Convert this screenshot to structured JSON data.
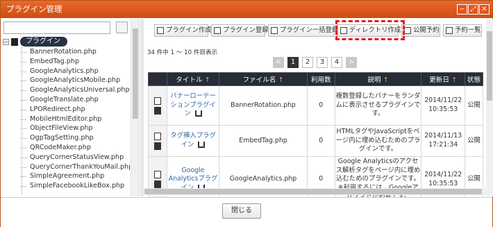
{
  "window": {
    "title": "プラグイン管理",
    "minimize_icon": "minimize-icon",
    "maximize_icon": "maximize-icon",
    "close_icon": "close-icon"
  },
  "sidebar": {
    "search_placeholder": "",
    "root_label": "プラグイン",
    "items": [
      "BannerRotation.php",
      "EmbedTag.php",
      "GoogleAnalytics.php",
      "GoogleAnalyticsMobile.php",
      "GoogleAnalyticsUniversal.php",
      "GoogleTranslate.php",
      "LPORedirect.php",
      "MobileHtmlEditor.php",
      "ObjectFileView.php",
      "OgpTagSetting.php",
      "QRCodeMaker.php",
      "QueryCornerStatusView.php",
      "QueryCornerThankYouMail.php",
      "SimpleAgreement.php",
      "SimpleFacebookLikeBox.php"
    ]
  },
  "toolbar": {
    "create": "プラグイン作成",
    "register": "プラグイン登録",
    "bulk_register": "プラグイン一括登録",
    "create_dir": "ディレクトリ作成",
    "schedule": "公開予約",
    "schedule_list": "予約一覧"
  },
  "listing": {
    "count_text": "34 件中 1 ～ 10 件目表示"
  },
  "pager": {
    "prev": "<",
    "pages": [
      "1",
      "2",
      "3",
      "4"
    ],
    "next": ">"
  },
  "table": {
    "headers": {
      "title": "タイトル",
      "filename": "ファイル名",
      "usage": "利用数",
      "desc": "説明",
      "updated": "更新日",
      "status": "状態",
      "sort_mark": "↑"
    },
    "rows": [
      {
        "title": "バナーローテーションプラグイン",
        "file": "BannerRotation.php",
        "usage": "0",
        "desc": "複数登録したバナーをランダムに表示させるプラグインです。",
        "date": "2014/11/22",
        "time": "10:35:53",
        "status": "公開"
      },
      {
        "title": "タグ挿入プラグイン",
        "file": "EmbedTag.php",
        "usage": "0",
        "desc": "HTMLタグやJavaScriptをページ内に埋め込むためのプラグインです。",
        "date": "2014/11/13",
        "time": "17:21:34",
        "status": "公開"
      },
      {
        "title": "Google Analyticsプラグイン",
        "file": "GoogleAnalytics.php",
        "usage": "0",
        "desc": "Google Analyticsのアクセス解析タグをページ内に埋め込むためのプラグインです。※利用するには、Googleアカウントが必要です。",
        "date": "2014/11/22",
        "time": "10:35:53",
        "status": "公開"
      }
    ]
  },
  "footer": {
    "close": "閉じる"
  },
  "colors": {
    "titlebar": "#d9531a",
    "header": "#262c38",
    "highlight": "#e02020",
    "link": "#2e67a8"
  }
}
